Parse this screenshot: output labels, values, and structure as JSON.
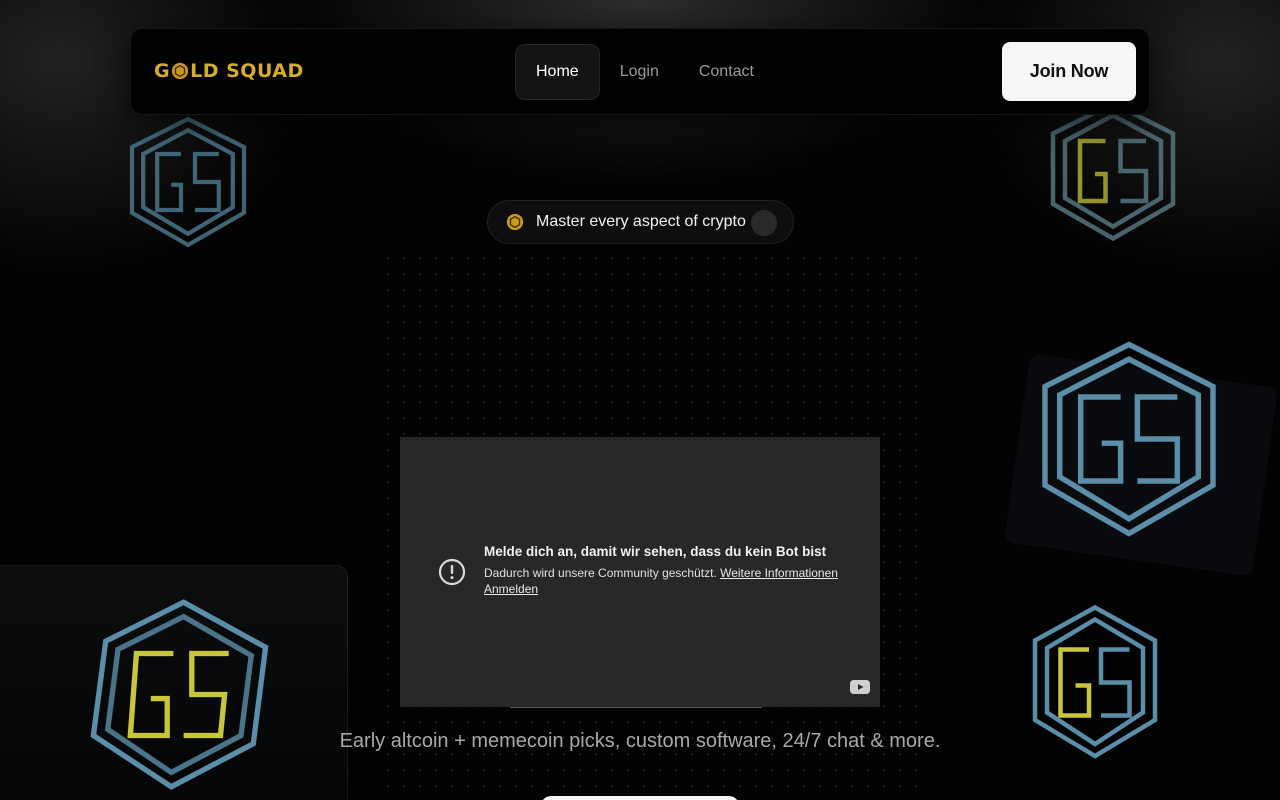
{
  "navbar": {
    "logo_text_1": "G",
    "logo_text_2": "LD SQUAD",
    "links": [
      {
        "label": "Home",
        "active": true
      },
      {
        "label": "Login",
        "active": false
      },
      {
        "label": "Contact",
        "active": false
      }
    ],
    "join_label": "Join Now"
  },
  "hero": {
    "pill_text": "Master every aspect of crypto",
    "tagline": "Early altcoin + memecoin picks, custom software, 24/7 chat & more."
  },
  "video": {
    "title": "Melde dich an, damit wir sehen, dass du kein Bot bist",
    "description": "Dadurch wird unsere Community geschützt.",
    "more_link": "Weitere Informationen",
    "signin": "Anmelden"
  },
  "colors": {
    "gold": "#d4ad2c",
    "teal_edge": "#4f7d93",
    "yellow_edge": "#c8c63a"
  },
  "icons": [
    "coin-icon",
    "alert-circle-icon",
    "youtube-icon",
    "gs-logo-icon"
  ]
}
